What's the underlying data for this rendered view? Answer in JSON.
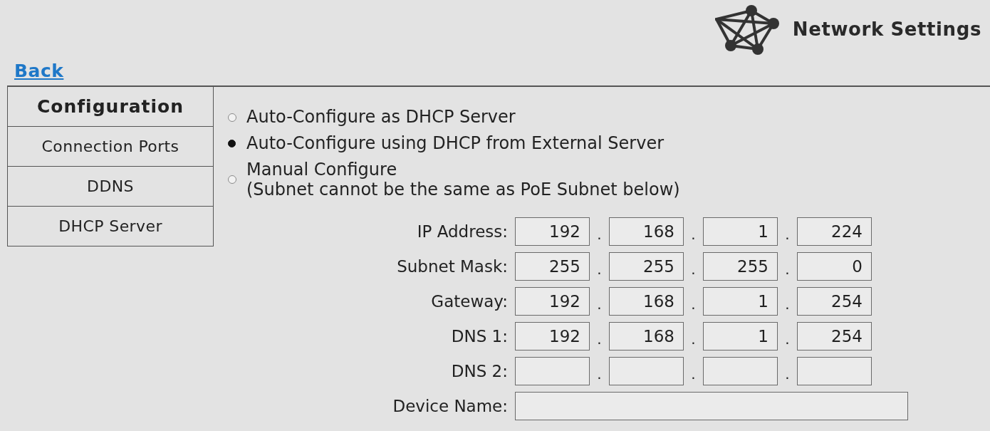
{
  "header": {
    "title": "Network Settings"
  },
  "back_link": {
    "label": "Back"
  },
  "tabs": [
    {
      "label": "Configuration",
      "selected": true
    },
    {
      "label": "Connection Ports",
      "selected": false
    },
    {
      "label": "DDNS",
      "selected": false
    },
    {
      "label": "DHCP Server",
      "selected": false
    }
  ],
  "modes": [
    {
      "label": "Auto-Configure as DHCP Server",
      "selected": false
    },
    {
      "label": "Auto-Configure using DHCP from External Server",
      "selected": true
    },
    {
      "label": "Manual Configure",
      "note": "(Subnet cannot be the same as PoE Subnet below)",
      "selected": false
    }
  ],
  "fields": [
    {
      "label": "IP Address:",
      "kind": "ip",
      "octets": [
        "192",
        "168",
        "1",
        "224"
      ],
      "separators": [
        ".",
        ".",
        "."
      ]
    },
    {
      "label": "Subnet Mask:",
      "kind": "ip",
      "octets": [
        "255",
        "255",
        "255",
        "0"
      ],
      "separators": [
        ".",
        ".",
        "."
      ]
    },
    {
      "label": "Gateway:",
      "kind": "ip",
      "octets": [
        "192",
        "168",
        "1",
        "254"
      ],
      "separators": [
        ".",
        ".",
        "."
      ]
    },
    {
      "label": "DNS 1:",
      "kind": "ip",
      "octets": [
        "192",
        "168",
        "1",
        "254"
      ],
      "separators": [
        ".",
        ".",
        "."
      ]
    },
    {
      "label": "DNS 2:",
      "kind": "ip",
      "separators": [
        ".",
        ".",
        "."
      ]
    },
    {
      "label": "Device Name:",
      "kind": "text"
    }
  ]
}
